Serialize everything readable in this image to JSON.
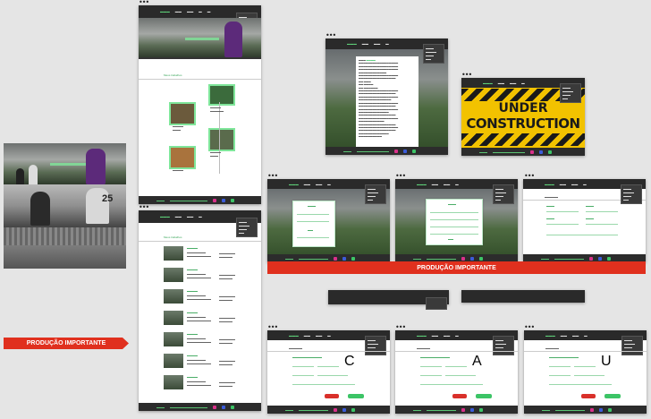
{
  "banners": {
    "left": "PRODUÇÃO IMPORTANTE",
    "center": "PRODUÇÃO IMPORTANTE"
  },
  "construction": {
    "line1": "UNDER",
    "line2": "CONSTRUCTION"
  },
  "letters": {
    "c": "C",
    "a": "A",
    "u": "U"
  },
  "home": {
    "section_title": "Meus trabalhos"
  },
  "list": {
    "section_title": "Meus trabalhos"
  },
  "colors": {
    "accent_green": "#3cc466",
    "banner_red": "#e0301e",
    "construction_yellow": "#f2c200"
  }
}
